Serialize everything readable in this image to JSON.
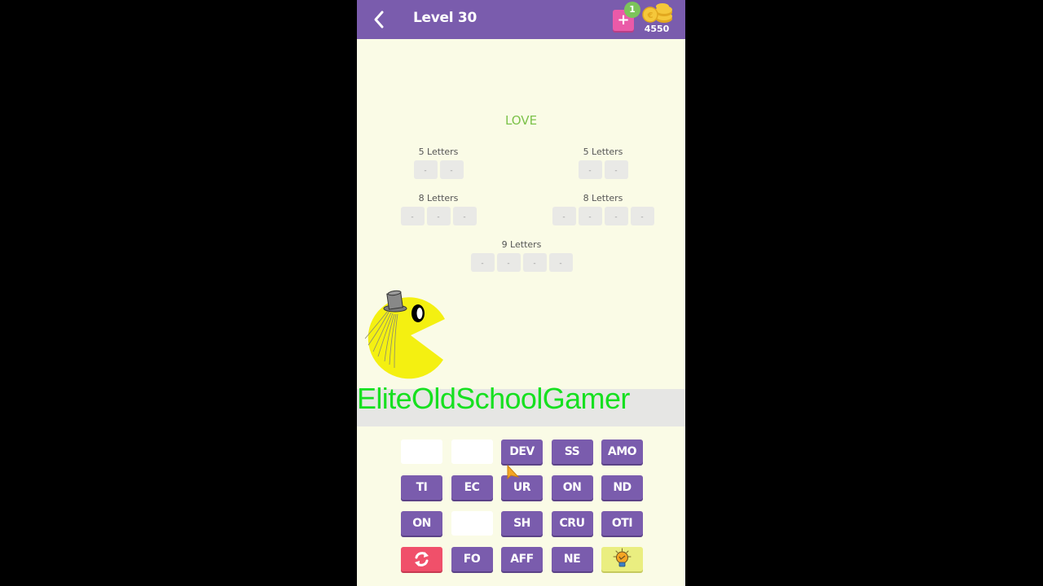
{
  "header": {
    "title": "Level 30",
    "back_icon": "chevron-left-icon",
    "add_icon": "plus-icon",
    "add_badge": "1",
    "coins_icon": "coins-icon",
    "coins": "4550",
    "accent": "#7a5cad"
  },
  "puzzle": {
    "theme": "LOVE",
    "groups": [
      {
        "label": "5 Letters",
        "slots": [
          "-",
          "-"
        ]
      },
      {
        "label": "5 Letters",
        "slots": [
          "-",
          "-"
        ]
      },
      {
        "label": "8 Letters",
        "slots": [
          "-",
          "-",
          "-"
        ]
      },
      {
        "label": "8 Letters",
        "slots": [
          "-",
          "-",
          "-",
          "-"
        ]
      },
      {
        "label": "9 Letters",
        "slots": [
          "-",
          "-",
          "-",
          "-"
        ]
      }
    ]
  },
  "overlay": {
    "watermark": "EliteOldSchoolGamer",
    "mascot": "pacman-with-top-hat"
  },
  "tiles": {
    "rows": [
      [
        {
          "label": "",
          "type": "empty"
        },
        {
          "label": "",
          "type": "empty"
        },
        {
          "label": "DEV",
          "type": "purple"
        },
        {
          "label": "SS",
          "type": "purple"
        },
        {
          "label": "AMO",
          "type": "purple"
        }
      ],
      [
        {
          "label": "TI",
          "type": "purple"
        },
        {
          "label": "EC",
          "type": "purple"
        },
        {
          "label": "UR",
          "type": "purple"
        },
        {
          "label": "ON",
          "type": "purple"
        },
        {
          "label": "ND",
          "type": "purple"
        }
      ],
      [
        {
          "label": "ON",
          "type": "purple"
        },
        {
          "label": "",
          "type": "empty"
        },
        {
          "label": "SH",
          "type": "purple"
        },
        {
          "label": "CRU",
          "type": "purple"
        },
        {
          "label": "OTI",
          "type": "purple"
        }
      ],
      [
        {
          "label": "",
          "type": "red",
          "icon": "shuffle-icon"
        },
        {
          "label": "FO",
          "type": "purple"
        },
        {
          "label": "AFF",
          "type": "purple"
        },
        {
          "label": "NE",
          "type": "purple"
        },
        {
          "label": "",
          "type": "yellow",
          "icon": "lightbulb-hint-icon"
        }
      ]
    ]
  }
}
